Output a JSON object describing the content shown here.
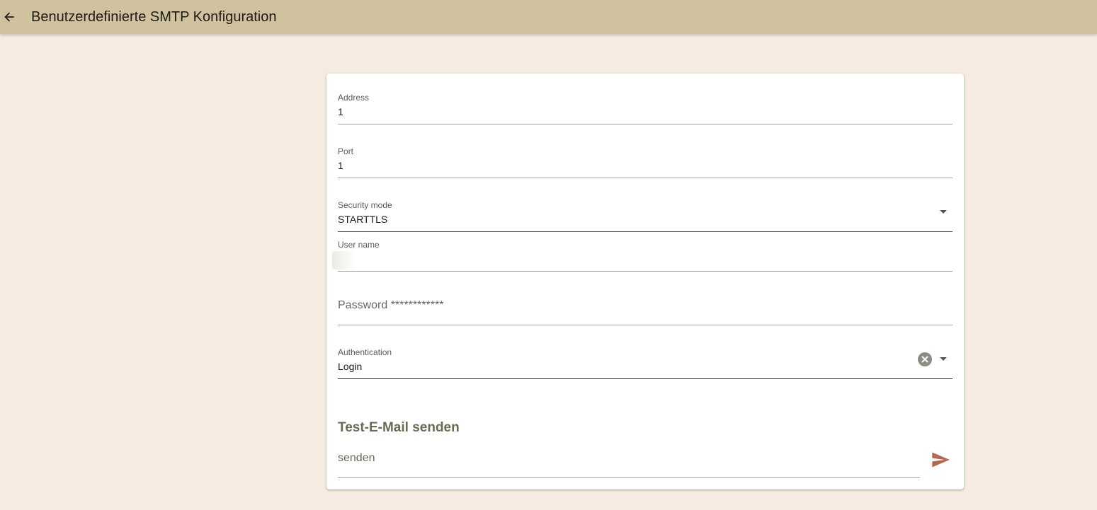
{
  "header": {
    "back_icon": "arrow-back-icon",
    "title": "Benutzerdefinierte SMTP Konfiguration"
  },
  "form": {
    "address": {
      "label": "Address",
      "value": "1"
    },
    "port": {
      "label": "Port",
      "value": "1"
    },
    "security_mode": {
      "label": "Security mode",
      "value": "STARTTLS"
    },
    "user_name": {
      "label": "User name",
      "value": ""
    },
    "password": {
      "placeholder": "Password ************"
    },
    "authentication": {
      "label": "Authentication",
      "value": "Login"
    }
  },
  "test_email": {
    "title": "Test-E-Mail senden",
    "input_placeholder": "senden",
    "send_icon": "send-icon"
  },
  "colors": {
    "topbar": "#d1c29f",
    "background": "#f5ebe1",
    "send_icon": "#b5674e"
  }
}
